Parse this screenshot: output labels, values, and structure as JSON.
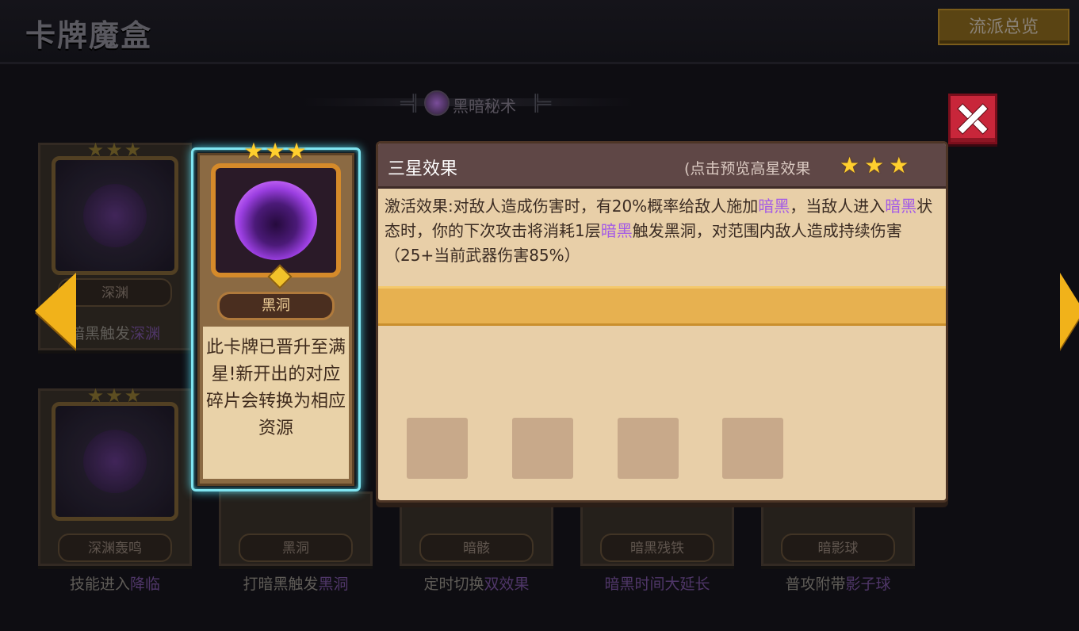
{
  "app_title": "卡牌魔盒",
  "overview_button": "流派总览",
  "section_title": "黑暗秘术",
  "cards": [
    {
      "name": "深渊",
      "caption_pre": "暗黑触发",
      "caption_hl": "深渊",
      "stars": "★★★"
    },
    {
      "name": "深渊轰鸣",
      "caption_pre": "技能进入",
      "caption_hl": "降临",
      "stars": "★★★"
    },
    {
      "name": "黑洞",
      "caption_pre": "打暗黑触发",
      "caption_hl": "黑洞",
      "stars": ""
    },
    {
      "name": "暗骸",
      "caption_pre": "定时切换",
      "caption_hl": "双效果",
      "stars": ""
    },
    {
      "name": "暗黑残铁",
      "caption_pre": "暗黑时间大延长",
      "caption_hl": "",
      "stars": ""
    },
    {
      "name": "暗影球",
      "caption_pre": "普攻附带",
      "caption_hl": "影子球",
      "stars": ""
    }
  ],
  "selected_card": {
    "name": "黑洞",
    "stars": "★★★",
    "note": "此卡牌已晋升至满星!新开出的对应碎片会转换为相应资源"
  },
  "panel": {
    "title": "三星效果",
    "hint": "(点击预览高星效果",
    "stars": "★★★",
    "desc_parts": [
      "激活效果:对敌人造成伤害时，有20%概率给敌人施加",
      "暗黑",
      "，当敌人进入",
      "暗黑",
      "状态时，你的下次攻击将消耗1层",
      "暗黑",
      "触发黑洞，对范围内敌人造成持续伤害（25+当前武器伤害85%）"
    ]
  },
  "colors": {
    "highlight": "#a45be6",
    "accent": "#e7b150",
    "selection_glow": "#7fe4f0",
    "close": "#c8263a"
  },
  "icons": {
    "left": "arrow-left-icon",
    "right": "arrow-right-icon",
    "close": "close-icon"
  }
}
